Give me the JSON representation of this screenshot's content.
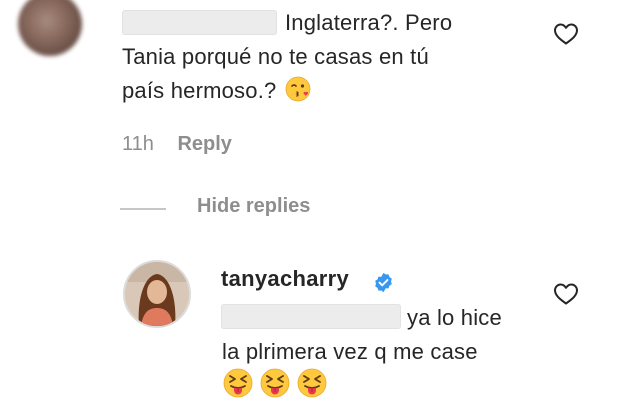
{
  "comment": {
    "line1_text": "Inglaterra?. Pero",
    "line2_text": "Tania porqué no te casas en tú",
    "line3_text": "país hermoso.?",
    "line3_emoji": "kissing-wink-emoji",
    "time": "11h",
    "reply_label": "Reply"
  },
  "thread": {
    "hide_replies_label": "Hide replies"
  },
  "reply": {
    "username": "tanyacharry",
    "verified": true,
    "line1_text": "ya lo hice",
    "line2_text": "la plrimera vez q me case",
    "emojis": [
      "squinting-tongue-emoji",
      "squinting-tongue-emoji",
      "squinting-tongue-emoji"
    ]
  },
  "colors": {
    "text": "#262626",
    "muted": "#8e8e8e",
    "verified": "#3897f0",
    "emoji_face": "#FFC83D"
  },
  "icons": [
    "heart-icon",
    "verified-badge-icon"
  ]
}
